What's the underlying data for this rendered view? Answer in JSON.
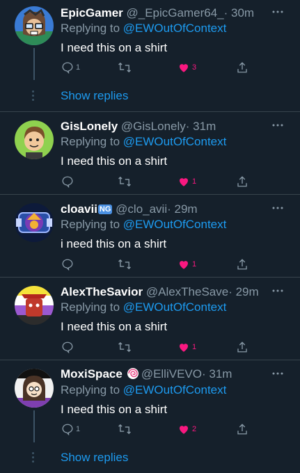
{
  "tweets": [
    {
      "name": "EpicGamer",
      "handle": "@_EpicGamer64_",
      "time": "· 30m",
      "replying_prefix": "Replying to ",
      "mention": "@EWOutOfContext",
      "text": "I need this on a shirt",
      "replies": "1",
      "retweets": "",
      "likes": "3",
      "liked": true,
      "show_replies": "Show replies"
    },
    {
      "name": "GisLonely",
      "handle": "@GisLonely",
      "time": "· 31m",
      "replying_prefix": "Replying to ",
      "mention": "@EWOutOfContext",
      "text": "I need this on a shirt",
      "replies": "",
      "retweets": "",
      "likes": "1",
      "liked": true
    },
    {
      "name": "cloavii",
      "badge": "NG",
      "handle": "@clo_avii",
      "time": "· 29m",
      "replying_prefix": "Replying to ",
      "mention": "@EWOutOfContext",
      "text": "i need this on a shirt",
      "replies": "",
      "retweets": "",
      "likes": "1",
      "liked": true
    },
    {
      "name": "AlexTheSavior",
      "handle": "@AlexTheSave",
      "time": "· 29m",
      "replying_prefix": "Replying to ",
      "mention": "@EWOutOfContext",
      "text": "I need this on a shirt",
      "replies": "",
      "retweets": "",
      "likes": "1",
      "liked": true
    },
    {
      "name": "MoxiSpace",
      "handle": "@ElliVEVO",
      "time": "· 31m",
      "replying_prefix": "Replying to ",
      "mention": "@EWOutOfContext",
      "text": "I need this on a shirt",
      "replies": "1",
      "retweets": "",
      "likes": "2",
      "liked": true,
      "show_replies": "Show replies"
    }
  ],
  "colors": {
    "background": "#15202b",
    "accent": "#1d9bf0",
    "like": "#f91880",
    "muted": "#8899a6",
    "divider": "#38444d"
  },
  "icons": [
    "reply-icon",
    "retweet-icon",
    "heart-icon",
    "share-icon",
    "more-icon",
    "lollipop-emoji-icon"
  ]
}
